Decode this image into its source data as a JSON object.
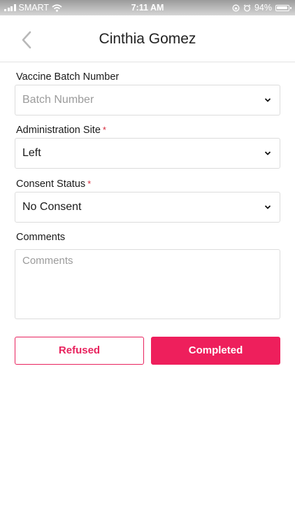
{
  "status_bar": {
    "carrier": "SMART",
    "time": "7:11 AM",
    "battery": "94%"
  },
  "header": {
    "title": "Cinthia Gomez"
  },
  "form": {
    "batch": {
      "label": "Vaccine Batch Number",
      "placeholder": "Batch Number",
      "value": ""
    },
    "site": {
      "label": "Administration Site",
      "required": "*",
      "value": "Left"
    },
    "consent": {
      "label": "Consent Status",
      "required": "*",
      "value": "No Consent"
    },
    "comments": {
      "label": "Comments",
      "placeholder": "Comments"
    }
  },
  "actions": {
    "refused_label": "Refused",
    "completed_label": "Completed"
  },
  "colors": {
    "accent": "#ee1f5c",
    "required": "#d62a3c"
  }
}
